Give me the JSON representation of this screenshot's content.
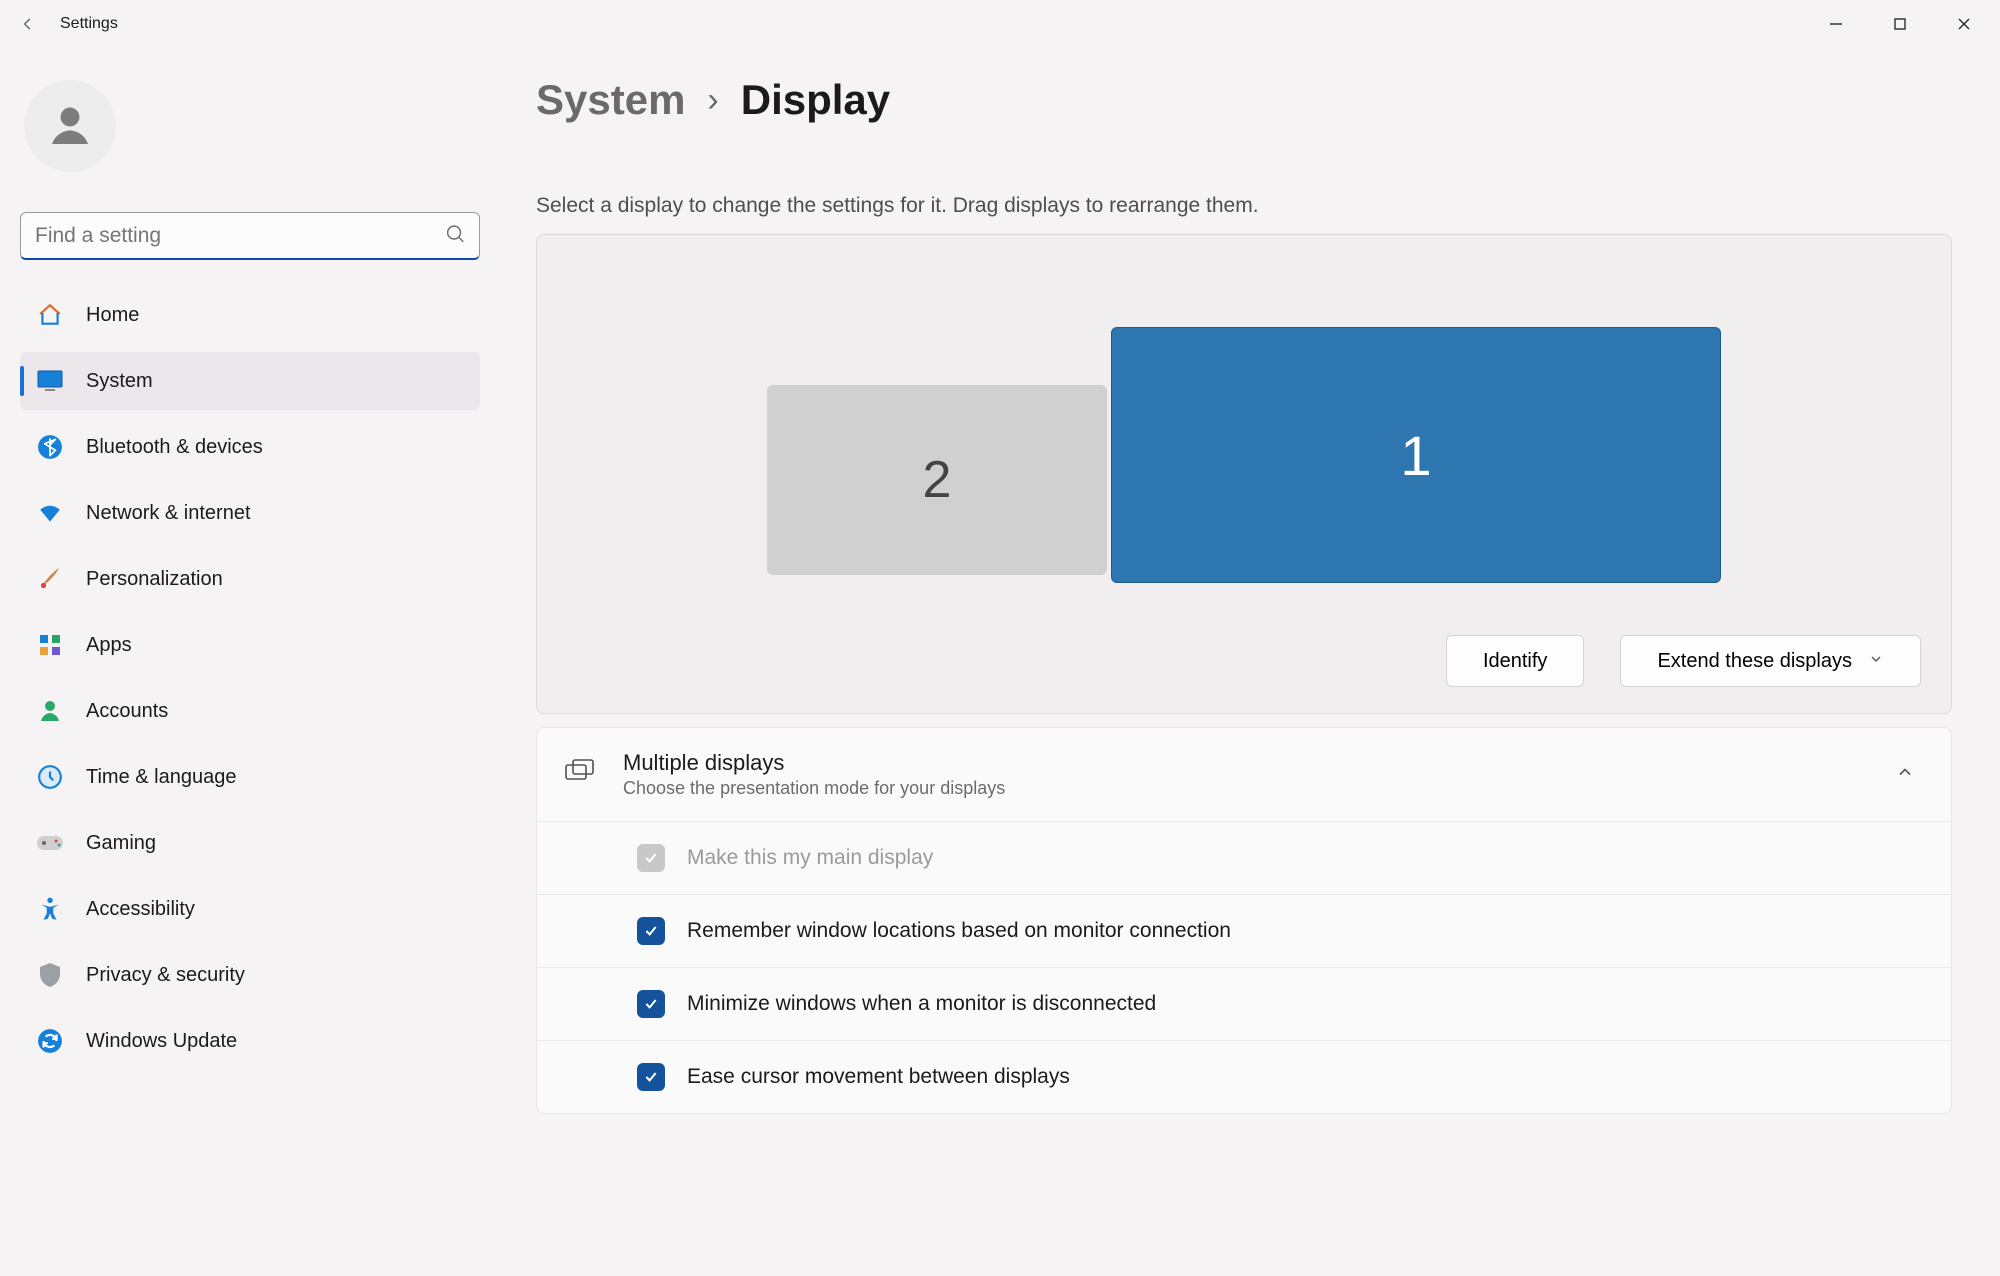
{
  "app": {
    "title": "Settings"
  },
  "search": {
    "placeholder": "Find a setting"
  },
  "sidebar": {
    "items": [
      {
        "label": "Home"
      },
      {
        "label": "System"
      },
      {
        "label": "Bluetooth & devices"
      },
      {
        "label": "Network & internet"
      },
      {
        "label": "Personalization"
      },
      {
        "label": "Apps"
      },
      {
        "label": "Accounts"
      },
      {
        "label": "Time & language"
      },
      {
        "label": "Gaming"
      },
      {
        "label": "Accessibility"
      },
      {
        "label": "Privacy & security"
      },
      {
        "label": "Windows Update"
      }
    ],
    "selected_index": 1
  },
  "breadcrumb": {
    "parent": "System",
    "current": "Display"
  },
  "display": {
    "hint": "Select a display to change the settings for it. Drag displays to rearrange them.",
    "monitors": {
      "primary_label": "1",
      "secondary_label": "2",
      "selected": "1"
    },
    "identify_label": "Identify",
    "mode_label": "Extend these displays"
  },
  "multiple_displays": {
    "title": "Multiple displays",
    "subtitle": "Choose the presentation mode for your displays",
    "options": [
      {
        "label": "Make this my main display",
        "checked": true,
        "disabled": true
      },
      {
        "label": "Remember window locations based on monitor connection",
        "checked": true,
        "disabled": false
      },
      {
        "label": "Minimize windows when a monitor is disconnected",
        "checked": true,
        "disabled": false
      },
      {
        "label": "Ease cursor movement between displays",
        "checked": true,
        "disabled": false
      }
    ]
  }
}
